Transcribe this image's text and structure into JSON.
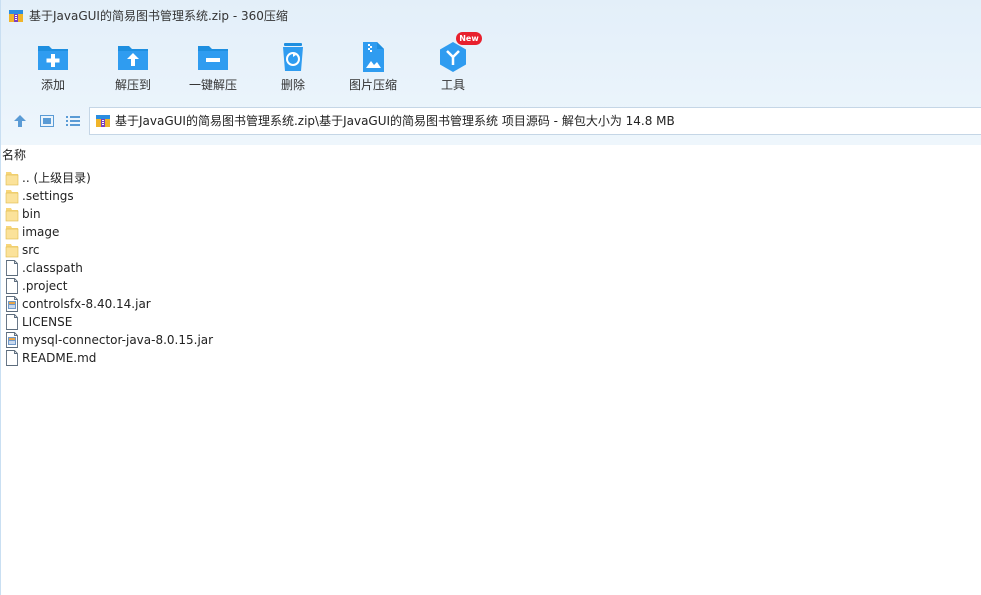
{
  "window": {
    "title": "基于JavaGUI的简易图书管理系统.zip - 360压缩"
  },
  "toolbar": {
    "buttons": [
      {
        "label": "添加",
        "icon": "add-folder-icon"
      },
      {
        "label": "解压到",
        "icon": "extract-to-icon"
      },
      {
        "label": "一键解压",
        "icon": "one-click-extract-icon"
      },
      {
        "label": "删除",
        "icon": "delete-icon"
      },
      {
        "label": "图片压缩",
        "icon": "image-compress-icon"
      },
      {
        "label": "工具",
        "icon": "tools-icon"
      }
    ],
    "new_badge": "New"
  },
  "nav": {
    "up_icon": "up-arrow-icon",
    "view_thumb_icon": "thumbnail-view-icon",
    "view_list_icon": "list-view-icon"
  },
  "address": {
    "path": "基于JavaGUI的简易图书管理系统.zip\\基于JavaGUI的简易图书管理系统 项目源码 - 解包大小为 14.8 MB"
  },
  "list": {
    "column_name": "名称",
    "items": [
      {
        "name": ".. (上级目录)",
        "type": "folder"
      },
      {
        "name": ".settings",
        "type": "folder"
      },
      {
        "name": "bin",
        "type": "folder"
      },
      {
        "name": "image",
        "type": "folder"
      },
      {
        "name": "src",
        "type": "folder"
      },
      {
        "name": ".classpath",
        "type": "file"
      },
      {
        "name": ".project",
        "type": "file"
      },
      {
        "name": "controlsfx-8.40.14.jar",
        "type": "jar"
      },
      {
        "name": "LICENSE",
        "type": "file"
      },
      {
        "name": "mysql-connector-java-8.0.15.jar",
        "type": "jar"
      },
      {
        "name": "README.md",
        "type": "file"
      }
    ]
  },
  "colors": {
    "accent": "#1e8fe0",
    "chrome_bg": "#e6f1fa",
    "badge": "#e8202d"
  }
}
